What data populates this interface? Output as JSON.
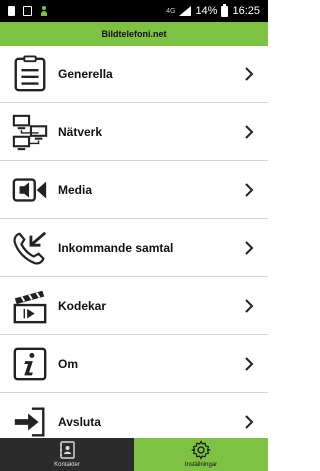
{
  "statusbar": {
    "network": "4G",
    "battery": "14%",
    "time": "16:25"
  },
  "header": {
    "title": "Bildtelefoni.net"
  },
  "settings": {
    "items": [
      {
        "label": "Generella",
        "icon": "document-list-icon"
      },
      {
        "label": "Nätverk",
        "icon": "network-icon"
      },
      {
        "label": "Media",
        "icon": "speaker-icon"
      },
      {
        "label": "Inkommande samtal",
        "icon": "incoming-call-icon"
      },
      {
        "label": "Kodekar",
        "icon": "clapperboard-icon"
      },
      {
        "label": "Om",
        "icon": "info-icon"
      },
      {
        "label": "Avsluta",
        "icon": "exit-icon"
      }
    ]
  },
  "tabbar": {
    "contacts_label": "Kontakter",
    "settings_label": "Inställningar"
  },
  "colors": {
    "accent": "#7dc242",
    "tab_dark": "#2b2b2b"
  }
}
